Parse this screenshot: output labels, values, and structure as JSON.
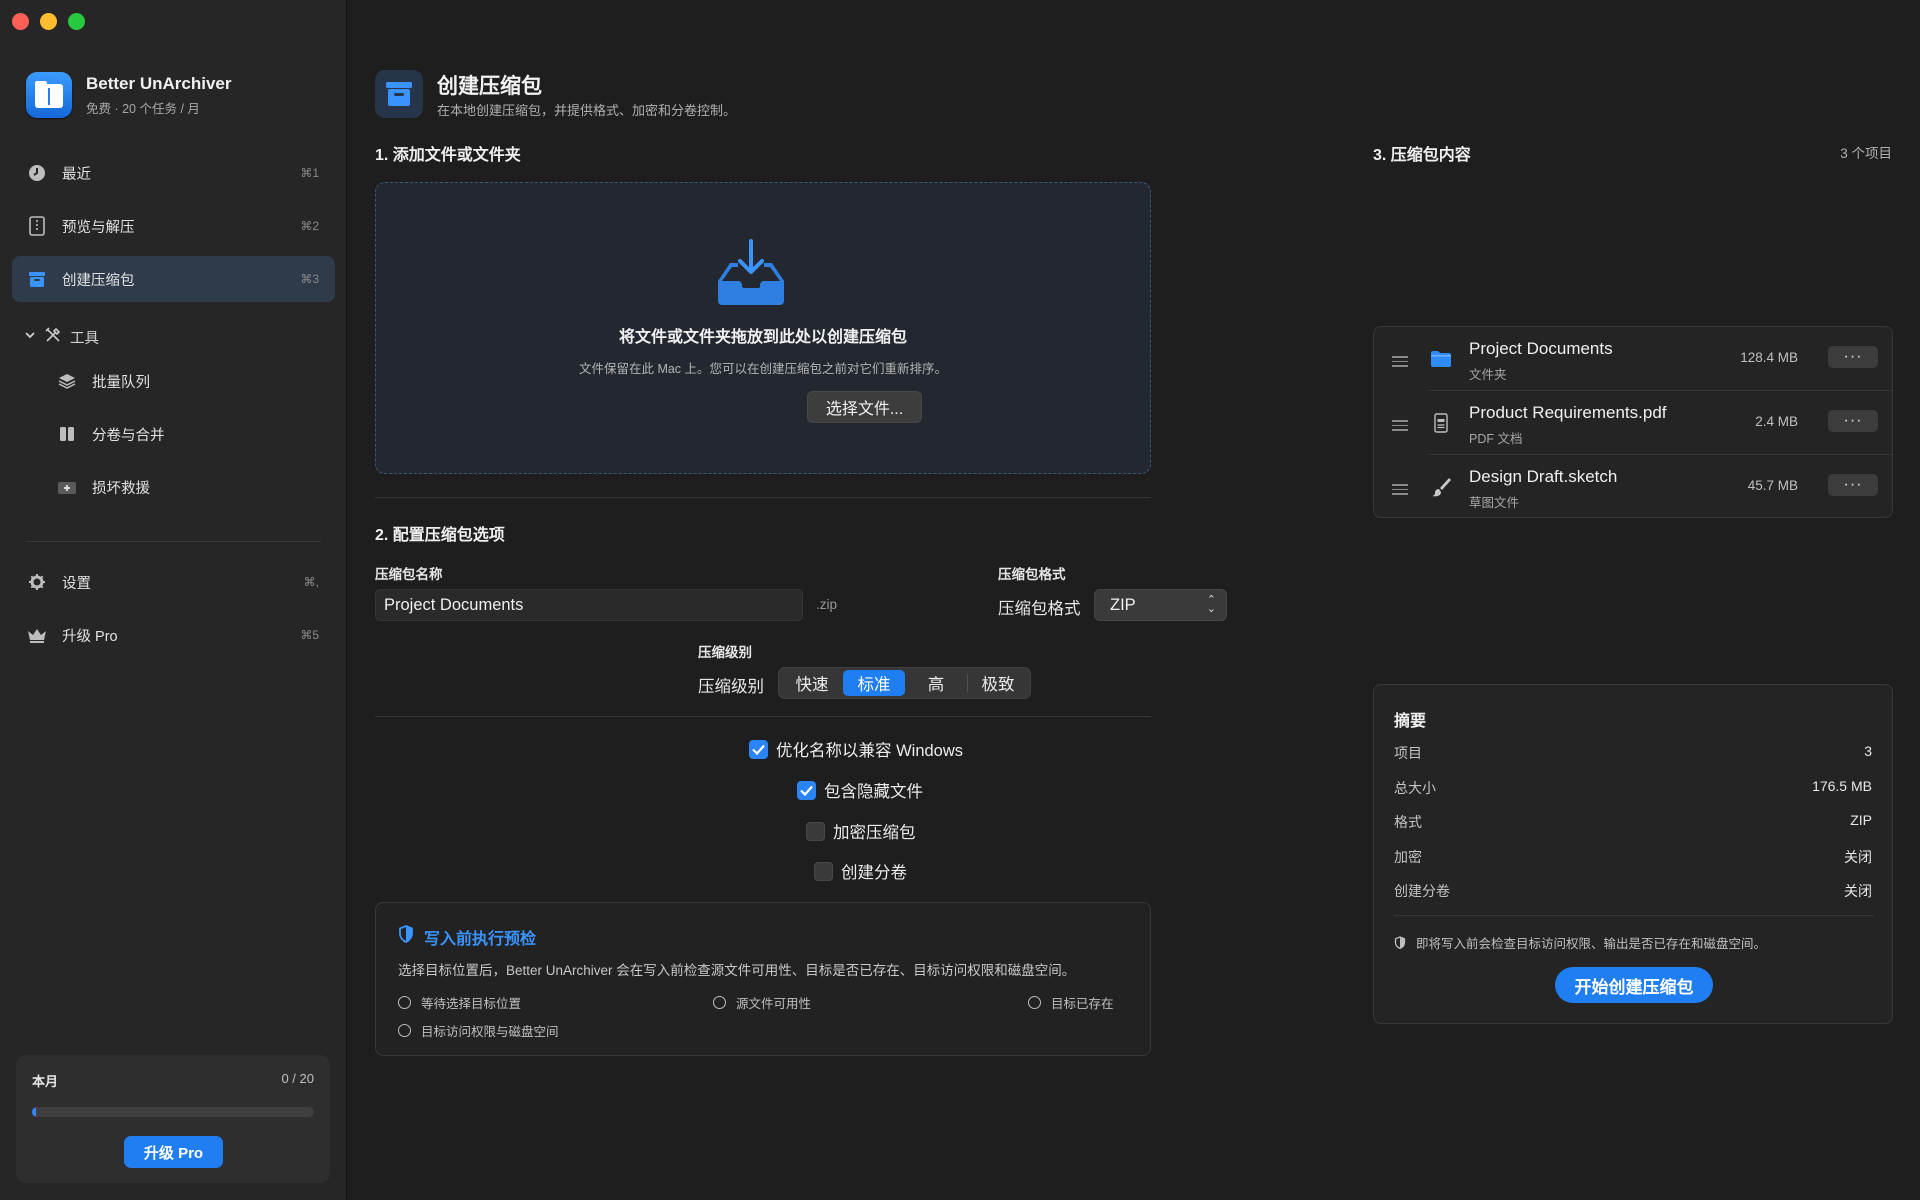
{
  "app": {
    "name": "Better UnArchiver",
    "plan": "免费 · 20 个任务 / 月"
  },
  "sidebar": {
    "items": [
      {
        "label": "最近",
        "shortcut": "⌘1"
      },
      {
        "label": "预览与解压",
        "shortcut": "⌘2"
      },
      {
        "label": "创建压缩包",
        "shortcut": "⌘3"
      },
      {
        "label": "批量队列"
      },
      {
        "label": "分卷与合并"
      },
      {
        "label": "损坏救援"
      },
      {
        "label": "设置",
        "shortcut": "⌘,"
      },
      {
        "label": "升级 Pro",
        "shortcut": "⌘5"
      }
    ],
    "group_label": "工具",
    "usage": {
      "label": "本月",
      "count": "0 / 20",
      "progress": 0.0,
      "button": "升级 Pro"
    }
  },
  "page": {
    "title": "创建压缩包",
    "subtitle": "在本地创建压缩包，并提供格式、加密和分卷控制。"
  },
  "section1": {
    "title": "1. 添加文件或文件夹",
    "drop_title": "将文件或文件夹拖放到此处以创建压缩包",
    "drop_sub": "文件保留在此 Mac 上。您可以在创建压缩包之前对它们重新排序。",
    "choose_button": "选择文件..."
  },
  "section2": {
    "title": "2. 配置压缩包选项",
    "name_label": "压缩包名称",
    "name_value": "Project Documents",
    "ext": ".zip",
    "format_label": "压缩包格式",
    "format_inline": "压缩包格式",
    "format_value": "ZIP",
    "level_label": "压缩级别",
    "level_inline": "压缩级别",
    "levels": [
      "快速",
      "标准",
      "高",
      "极致"
    ],
    "level_selected": "标准",
    "options": [
      {
        "label": "优化名称以兼容 Windows",
        "checked": true
      },
      {
        "label": "包含隐藏文件",
        "checked": true
      },
      {
        "label": "加密压缩包",
        "checked": false
      },
      {
        "label": "创建分卷",
        "checked": false
      }
    ]
  },
  "precheck": {
    "title": "写入前执行预检",
    "desc": "选择目标位置后，Better UnArchiver 会在写入前检查源文件可用性、目标是否已存在、目标访问权限和磁盘空间。",
    "items": [
      "等待选择目标位置",
      "源文件可用性",
      "目标已存在",
      "目标访问权限与磁盘空间"
    ]
  },
  "section3": {
    "title": "3. 压缩包内容",
    "count": "3 个项目",
    "files": [
      {
        "name": "Project Documents",
        "kind": "文件夹",
        "size": "128.4 MB",
        "icon": "folder-icon"
      },
      {
        "name": "Product Requirements.pdf",
        "kind": "PDF 文档",
        "size": "2.4 MB",
        "icon": "pdf-icon"
      },
      {
        "name": "Design Draft.sketch",
        "kind": "草图文件",
        "size": "45.7 MB",
        "icon": "brush-icon"
      }
    ],
    "more_label": "···"
  },
  "summary": {
    "title": "摘要",
    "rows": [
      {
        "k": "项目",
        "v": "3"
      },
      {
        "k": "总大小",
        "v": "176.5 MB"
      },
      {
        "k": "格式",
        "v": "ZIP"
      },
      {
        "k": "加密",
        "v": "关闭"
      },
      {
        "k": "创建分卷",
        "v": "关闭"
      }
    ],
    "note": "即将写入前会检查目标访问权限、输出是否已存在和磁盘空间。",
    "start_button": "开始创建压缩包"
  },
  "colors": {
    "accent": "#1f7ef2",
    "sidebar": "#262626",
    "background": "#1e1e1e"
  }
}
